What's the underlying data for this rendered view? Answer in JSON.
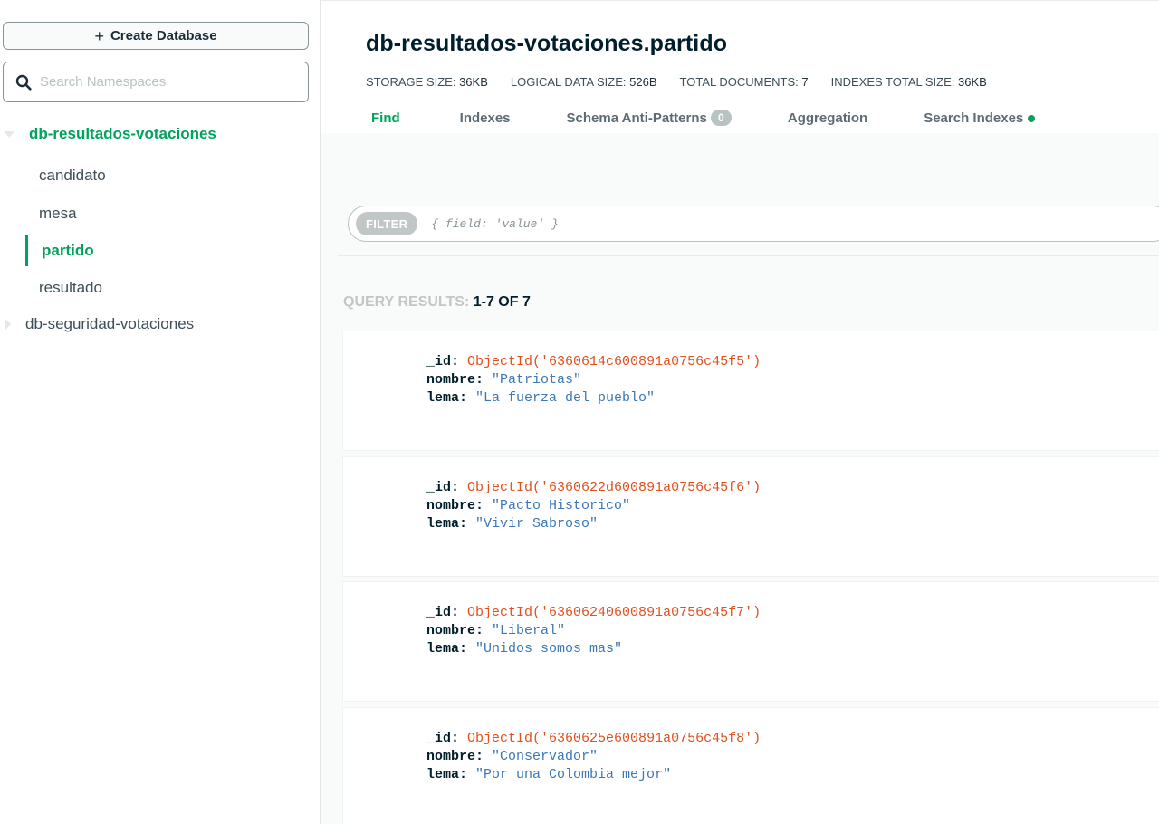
{
  "sidebar": {
    "create_db_label": "Create Database",
    "search_placeholder": "Search Namespaces",
    "databases": [
      {
        "name": "db-resultados-votaciones",
        "expanded": true,
        "collections": [
          "candidato",
          "mesa",
          "partido",
          "resultado"
        ],
        "active_collection": "partido"
      },
      {
        "name": "db-seguridad-votaciones",
        "expanded": false
      }
    ]
  },
  "header": {
    "namespace": "db-resultados-votaciones.partido",
    "stats": [
      {
        "label": "STORAGE SIZE:",
        "value": "36KB"
      },
      {
        "label": "LOGICAL DATA SIZE:",
        "value": "526B"
      },
      {
        "label": "TOTAL DOCUMENTS:",
        "value": "7"
      },
      {
        "label": "INDEXES TOTAL SIZE:",
        "value": "36KB"
      }
    ],
    "tabs": {
      "find": "Find",
      "indexes": "Indexes",
      "schema": "Schema Anti-Patterns",
      "schema_badge": "0",
      "aggregation": "Aggregation",
      "search_indexes": "Search Indexes"
    }
  },
  "filter": {
    "label": "FILTER",
    "placeholder": "{ field: 'value' }"
  },
  "results": {
    "label": "QUERY RESULTS:",
    "range": "1-7 OF 7"
  },
  "documents": [
    {
      "id": "ObjectId('6360614c600891a0756c45f5')",
      "nombre": "\"Patriotas\"",
      "lema": "\"La fuerza del pueblo\""
    },
    {
      "id": "ObjectId('6360622d600891a0756c45f6')",
      "nombre": "\"Pacto Historico\"",
      "lema": "\"Vivir Sabroso\""
    },
    {
      "id": "ObjectId('63606240600891a0756c45f7')",
      "nombre": "\"Liberal\"",
      "lema": "\"Unidos somos mas\""
    },
    {
      "id": "ObjectId('6360625e600891a0756c45f8')",
      "nombre": "\"Conservador\"",
      "lema": "\"Por una Colombia mejor\""
    }
  ],
  "field_names": {
    "id": "_id:",
    "nombre": "nombre:",
    "lema": "lema:"
  },
  "colors": {
    "accent": "#00a35c",
    "objectid": "#e2501e",
    "string": "#3b78b5"
  }
}
